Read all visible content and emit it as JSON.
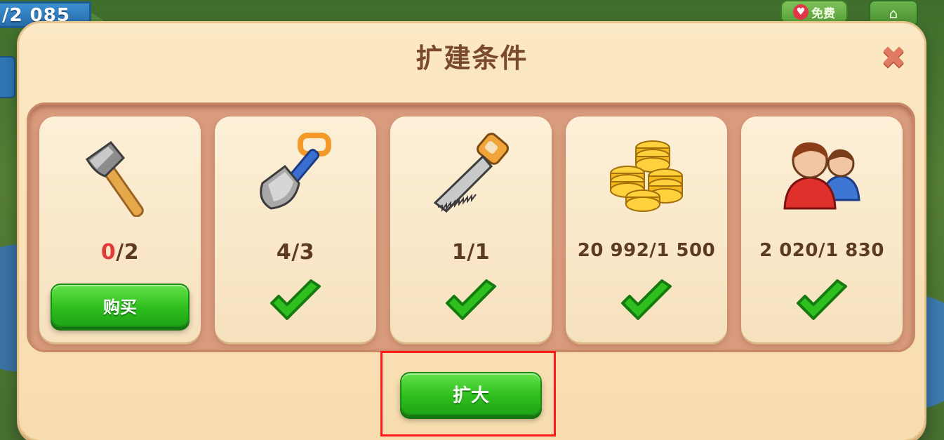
{
  "hud": {
    "counter_text": "/2 085",
    "free_label": "免费",
    "free_icon": "heart-icon",
    "home_icon": "home-icon"
  },
  "dialog": {
    "title": "扩建条件",
    "close_icon": "close-icon"
  },
  "requirements": [
    {
      "name": "axe",
      "icon": "axe-icon",
      "have": "0",
      "need": "2",
      "met": false,
      "action_label": "购买"
    },
    {
      "name": "shovel",
      "icon": "shovel-icon",
      "have": "4",
      "need": "3",
      "met": true
    },
    {
      "name": "saw",
      "icon": "saw-icon",
      "have": "1",
      "need": "1",
      "met": true
    },
    {
      "name": "coins",
      "icon": "coins-icon",
      "have": "20 992",
      "need": "1 500",
      "met": true
    },
    {
      "name": "population",
      "icon": "people-icon",
      "have": "2 020",
      "need": "1 830",
      "met": true
    }
  ],
  "counts": {
    "axe_have": "0",
    "axe_rest": "/2",
    "shovel": "4/3",
    "saw": "1/1",
    "coins": "20 992/1 500",
    "population": "2 020/1 830"
  },
  "buttons": {
    "buy_label": "购买",
    "expand_label": "扩大"
  },
  "colors": {
    "accent_green": "#2fbf1e",
    "unmet_red": "#e23a3a",
    "title_brown": "#7a4a2c",
    "highlight_red": "#ff1a1a"
  }
}
